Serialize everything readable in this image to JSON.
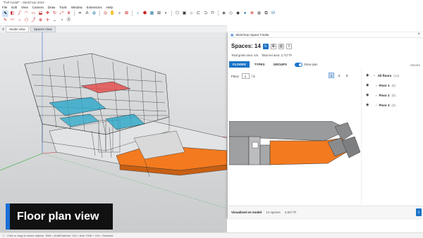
{
  "window": {
    "title": "\"Full model\" - SketchUp 2024"
  },
  "menu": [
    "File",
    "Edit",
    "View",
    "Camera",
    "Draw",
    "Tools",
    "Window",
    "Extensions",
    "Help"
  ],
  "toolbar_row1": [
    "select-icon",
    "eraser-icon",
    "line-icon",
    "arc-icon",
    "rectangle-icon",
    "push-pull-icon",
    "move-icon",
    "rotate-icon",
    "scale-icon",
    "offset-icon",
    "tape-icon",
    "text-icon",
    "paint-icon",
    "orbit-icon",
    "pan-icon",
    "zoom-icon",
    "zoom-extents-icon",
    "warehouse-icon",
    "extension-icon",
    "space-finder-icon",
    "sections-icon",
    "styles-icon"
  ],
  "toolbar_row2": [
    "iso-view-icon",
    "top-view-icon",
    "front-view-icon",
    "right-view-icon",
    "back-view-icon",
    "left-view-icon",
    "xray-icon",
    "wireframe-icon",
    "hidden-line-icon",
    "shaded-icon",
    "textured-icon",
    "monochrome-icon",
    "section-plane-icon",
    "solid-tools-icon"
  ],
  "scenes": {
    "tabs": [
      "Model view",
      "Spaces View"
    ],
    "selected": 1
  },
  "overlay": {
    "title": "Floor plan view",
    "accent": "#1a6fd6"
  },
  "status": {
    "text": "Click or drag to select objects. Shift = Add/Subtract. Ctrl = Add. Shift + Ctrl = Subtract."
  },
  "panel": {
    "title": "SketchUp Space Finder",
    "close": "×",
    "spaces_title": "Spaces: 14",
    "gross_area": "Total gross area: n/a",
    "net_area": "Total net area: 2,717 ft²",
    "tabs": [
      "FLOORS",
      "TYPES",
      "GROUPS"
    ],
    "selected_tab": 0,
    "toggle_label": "Show plan",
    "unit": "GROSS",
    "floor_label": "Floor:",
    "floor_value": "1",
    "floor_total": "/ 3",
    "pages": [
      "1",
      "2",
      "3"
    ],
    "selected_page": 0,
    "tree": [
      {
        "label": "All floors",
        "count": "(14)"
      },
      {
        "label": "Floor 1",
        "count": "(6)"
      },
      {
        "label": "Floor 2",
        "count": "(5)"
      },
      {
        "label": "Floor 3",
        "count": "(3)"
      }
    ],
    "footer": {
      "label": "Visualized on model",
      "spaces": "14 spaces",
      "area": "2,827 ft²"
    },
    "colors": {
      "accent": "#1a73c7",
      "space_orange": "#f47a1f"
    }
  }
}
